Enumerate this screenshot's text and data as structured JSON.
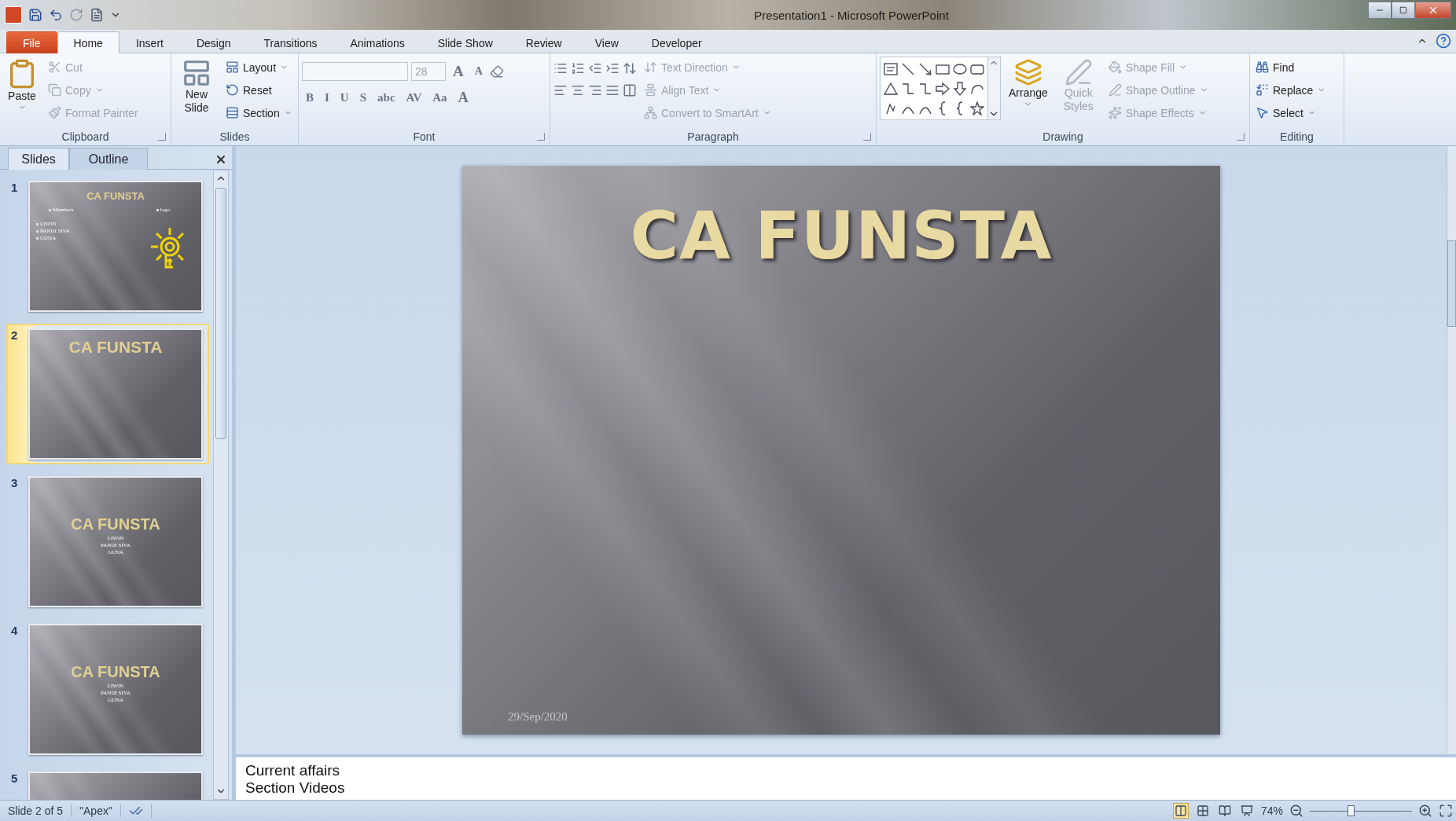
{
  "window": {
    "title": "Presentation1  -  Microsoft PowerPoint"
  },
  "ribbon_tabs": [
    {
      "label": "File",
      "kind": "file",
      "selected": false
    },
    {
      "label": "Home",
      "kind": "tab",
      "selected": true
    },
    {
      "label": "Insert",
      "kind": "tab",
      "selected": false
    },
    {
      "label": "Design",
      "kind": "tab",
      "selected": false
    },
    {
      "label": "Transitions",
      "kind": "tab",
      "selected": false
    },
    {
      "label": "Animations",
      "kind": "tab",
      "selected": false
    },
    {
      "label": "Slide Show",
      "kind": "tab",
      "selected": false
    },
    {
      "label": "Review",
      "kind": "tab",
      "selected": false
    },
    {
      "label": "View",
      "kind": "tab",
      "selected": false
    },
    {
      "label": "Developer",
      "kind": "tab",
      "selected": false
    }
  ],
  "clipboard": {
    "label": "Clipboard",
    "launcher": true,
    "paste": "Paste",
    "items": [
      {
        "label": "Cut",
        "disabled": true,
        "dropdown": false
      },
      {
        "label": "Copy",
        "disabled": true,
        "dropdown": true
      },
      {
        "label": "Format Painter",
        "disabled": true,
        "dropdown": false
      }
    ]
  },
  "slides_group": {
    "label": "Slides",
    "launcher": false,
    "new_slide": "New Slide",
    "items": [
      {
        "label": "Layout",
        "disabled": false,
        "dropdown": true
      },
      {
        "label": "Reset",
        "disabled": false,
        "dropdown": false
      },
      {
        "label": "Section",
        "disabled": false,
        "dropdown": true
      }
    ]
  },
  "font": {
    "label": "Font",
    "launcher": true,
    "size": "28",
    "grow": "A",
    "shrink": "A",
    "formats": [
      "B",
      "I",
      "U",
      "S",
      "abc",
      "AV",
      "Aa"
    ],
    "color_button": "A"
  },
  "paragraph": {
    "label": "Paragraph",
    "launcher": true,
    "items": [
      {
        "label": "Text Direction",
        "disabled": true,
        "dropdown": true
      },
      {
        "label": "Align Text",
        "disabled": true,
        "dropdown": true
      },
      {
        "label": "Convert to SmartArt",
        "disabled": true,
        "dropdown": true
      }
    ]
  },
  "drawing": {
    "label": "Drawing",
    "launcher": true,
    "arrange": "Arrange",
    "quick_styles": "Quick Styles",
    "quick_styles_disabled": true,
    "items": [
      {
        "label": "Shape Fill",
        "disabled": true,
        "dropdown": true
      },
      {
        "label": "Shape Outline",
        "disabled": true,
        "dropdown": true
      },
      {
        "label": "Shape Effects",
        "disabled": true,
        "dropdown": true
      }
    ]
  },
  "editing": {
    "label": "Editing",
    "launcher": false,
    "items": [
      {
        "label": "Find",
        "disabled": false,
        "dropdown": false
      },
      {
        "label": "Replace",
        "disabled": false,
        "dropdown": true
      },
      {
        "label": "Select",
        "disabled": false,
        "dropdown": true
      }
    ]
  },
  "pane_tabs": [
    {
      "label": "Slides",
      "selected": true
    },
    {
      "label": "Outline",
      "selected": false
    }
  ],
  "thumbnails": [
    {
      "number": "1",
      "selected": false,
      "kind": "members",
      "title": "CA FUNSTA",
      "heading_left": "Members",
      "heading_right": "logo",
      "names": [
        "LIWIN",
        "PANDI SIVA",
        "GUNA"
      ]
    },
    {
      "number": "2",
      "selected": true,
      "kind": "title",
      "title": "CA FUNSTA"
    },
    {
      "number": "3",
      "selected": false,
      "kind": "names",
      "title": "CA FUNSTA",
      "names": [
        "LIWIN",
        "PANDI SIVA",
        "GUNA"
      ]
    },
    {
      "number": "4",
      "selected": false,
      "kind": "names",
      "title": "CA FUNSTA",
      "names": [
        "LIWIN",
        "PANDI SIVA",
        "GUNA"
      ]
    },
    {
      "number": "5",
      "selected": false,
      "kind": "blank"
    }
  ],
  "slide": {
    "title": "CA FUNSTA",
    "date": "29/Sep/2020"
  },
  "notes": [
    "Current affairs",
    "Section Videos"
  ],
  "status_bar": {
    "slide": "Slide 2 of 5",
    "theme": "\"Apex\"",
    "zoom": "74%",
    "zoom_slider": {
      "level": 0.4
    }
  }
}
